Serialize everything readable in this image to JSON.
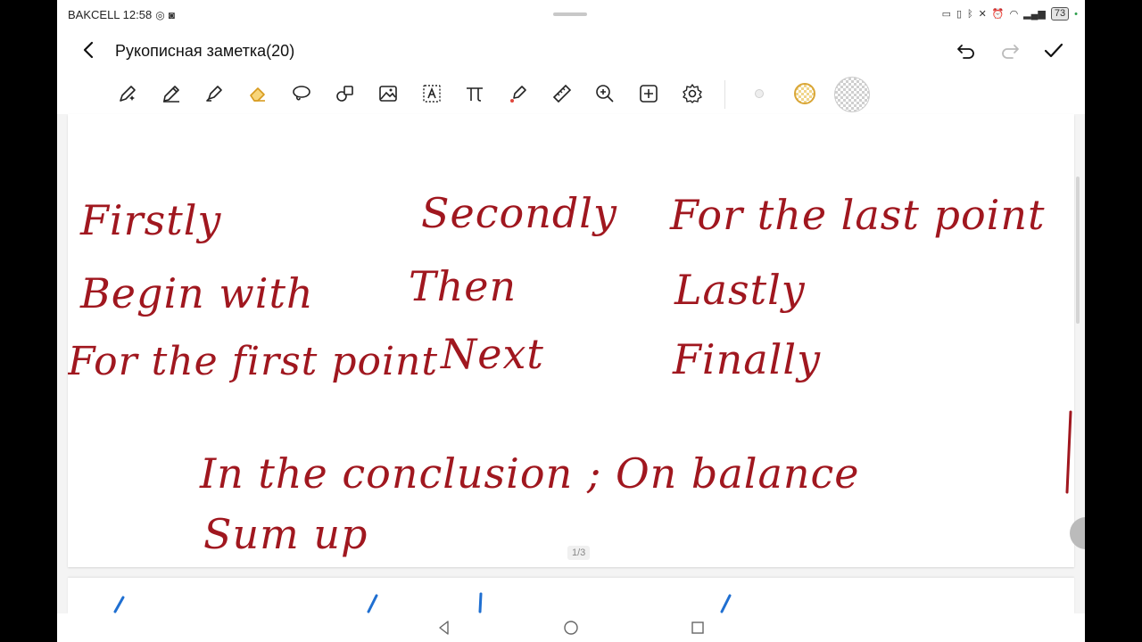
{
  "status": {
    "carrier_time": "BAKCELL 12:58",
    "battery": "73"
  },
  "header": {
    "title": "Рукописная заметка(20)"
  },
  "toolbar": {
    "tools": [
      "ai-pen-icon",
      "pen-icon",
      "highlighter-icon",
      "eraser-icon",
      "lasso-icon",
      "shapes-icon",
      "image-icon",
      "text-icon",
      "formula-icon",
      "magic-pen-icon",
      "ruler-icon",
      "zoom-icon",
      "add-page-icon",
      "settings-icon"
    ],
    "active_tool": "eraser-icon",
    "swatch_colors": [
      "#d8d8d8",
      "#e8c56a",
      "#c9c9c9"
    ]
  },
  "note": {
    "row1": [
      "Firstly",
      "Secondly",
      "For the last point"
    ],
    "row2": [
      "Begin with",
      "Then",
      "Lastly"
    ],
    "row3": [
      "For the first point",
      "Next",
      "Finally"
    ],
    "conclusion": "In the conclusion ; On balance",
    "sum_up": "Sum up",
    "ink_color": "#a0171f",
    "page_indicator": "1/3"
  }
}
